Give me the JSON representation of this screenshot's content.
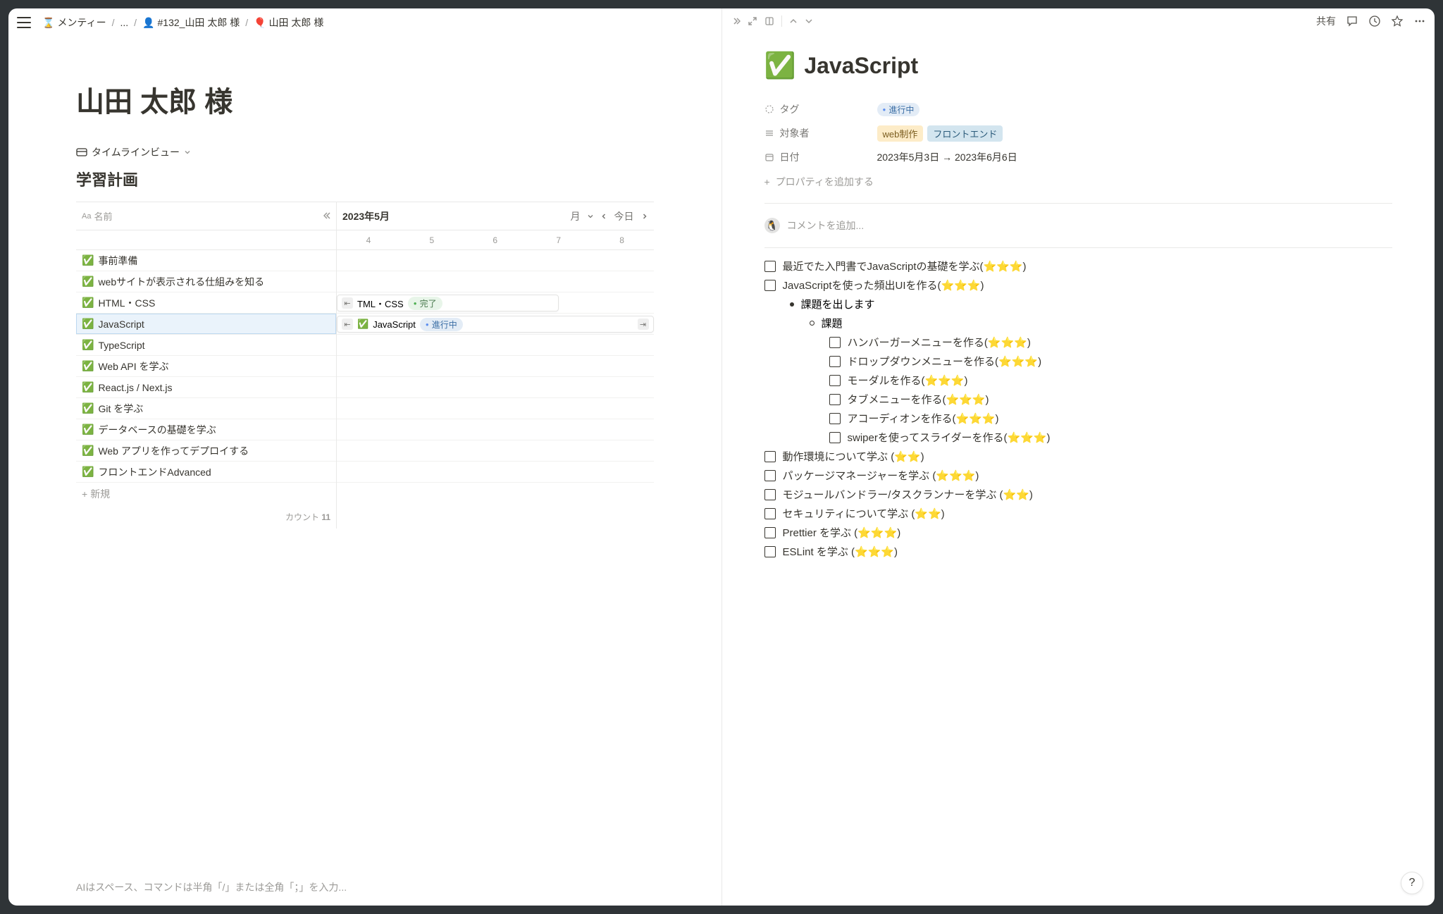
{
  "breadcrumbs": {
    "b0_emoji": "⌛",
    "b0": "メンティー",
    "b1": "...",
    "b2_emoji": "👤",
    "b2": "#132_山田 太郎 様",
    "b3_emoji": "🎈",
    "b3": "山田 太郎 様"
  },
  "left": {
    "title": "山田 太郎 様",
    "view_label": "タイムラインビュー",
    "db_title": "学習計画",
    "name_header": "名前",
    "month_label": "2023年5月",
    "month_unit": "月",
    "today": "今日",
    "days": [
      "4",
      "5",
      "6",
      "7",
      "8"
    ],
    "rows": [
      "事前準備",
      "webサイトが表示される仕組みを知る",
      "HTML・CSS",
      "JavaScript",
      "TypeScript",
      "Web API を学ぶ",
      "React.js / Next.js",
      "Git を学ぶ",
      "データベースの基礎を学ぶ",
      "Web アプリを作ってデプロイする",
      "フロントエンドAdvanced"
    ],
    "bar_htmlcss": "TML・CSS",
    "bar_htmlcss_status": "完了",
    "bar_js": "JavaScript",
    "bar_js_status": "進行中",
    "new_label": "新規",
    "count_label": "カウント",
    "count_value": "11",
    "ai_hint": "AIはスペース、コマンドは半角「/」または全角「；」を入力..."
  },
  "right_top": {
    "share": "共有"
  },
  "detail": {
    "emoji": "✅",
    "title": "JavaScript",
    "props": {
      "tag_label": "タグ",
      "tag_value": "進行中",
      "target_label": "対象者",
      "target_v1": "web制作",
      "target_v2": "フロントエンド",
      "date_label": "日付",
      "date_value": "2023年5月3日 → 2023年6月6日"
    },
    "add_prop": "プロパティを追加する",
    "comment_placeholder": "コメントを追加...",
    "todos": {
      "t1": "最近でた入門書でJavaScriptの基礎を学ぶ(⭐⭐⭐)",
      "t2": "JavaScriptを使った頻出UIを作る(⭐⭐⭐)",
      "b1": "課題を出します",
      "b2": "課題",
      "s1": "ハンバーガーメニューを作る(⭐⭐⭐)",
      "s2": "ドロップダウンメニューを作る(⭐⭐⭐)",
      "s3": "モーダルを作る(⭐⭐⭐)",
      "s4": "タブメニューを作る(⭐⭐⭐)",
      "s5": "アコーディオンを作る(⭐⭐⭐)",
      "s6": "swiperを使ってスライダーを作る(⭐⭐⭐)",
      "t3": "動作環境について学ぶ (⭐⭐)",
      "t4": "パッケージマネージャーを学ぶ (⭐⭐⭐)",
      "t5": "モジュールバンドラー/タスクランナーを学ぶ (⭐⭐)",
      "t6": "セキュリティについて学ぶ (⭐⭐)",
      "t7": "Prettier を学ぶ (⭐⭐⭐)",
      "t8": "ESLint を学ぶ (⭐⭐⭐)"
    }
  }
}
